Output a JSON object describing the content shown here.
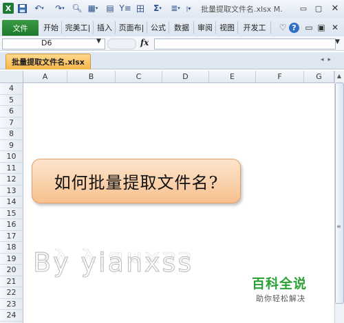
{
  "app": {
    "icon_letter": "X",
    "window_title": "批量提取文件名.xlsx M."
  },
  "qat": {
    "icons": [
      "save-icon",
      "undo-icon",
      "redo-icon",
      "print-preview-icon",
      "format-painter-icon",
      "paste-icon",
      "filter-icon",
      "borders-icon",
      "sum-icon",
      "align-icon",
      "customize-icon"
    ]
  },
  "ribbon": {
    "file_label": "文件",
    "tabs": [
      "开始",
      "完美工|",
      "插入",
      "页面布|",
      "公式",
      "数据",
      "审阅",
      "视图",
      "开发工"
    ],
    "accent_color": "#1f7a2c"
  },
  "formula_bar": {
    "name_box": "D6",
    "fx": "fx",
    "formula": ""
  },
  "workbook": {
    "tab_label": "批量提取文件名.xlsx"
  },
  "grid": {
    "columns": [
      "A",
      "B",
      "C",
      "D",
      "E",
      "F",
      "G"
    ],
    "rows": [
      "4",
      "5",
      "6",
      "7",
      "8",
      "9",
      "10",
      "11",
      "12",
      "13",
      "14",
      "15",
      "16",
      "17",
      "18",
      "19",
      "20",
      "21",
      "22",
      "23",
      "24"
    ]
  },
  "content": {
    "callout_text": "如何批量提取文件名?",
    "watermark": "By yianxss",
    "brand_title": "百科全说",
    "brand_subtitle": "助你轻松解决"
  }
}
